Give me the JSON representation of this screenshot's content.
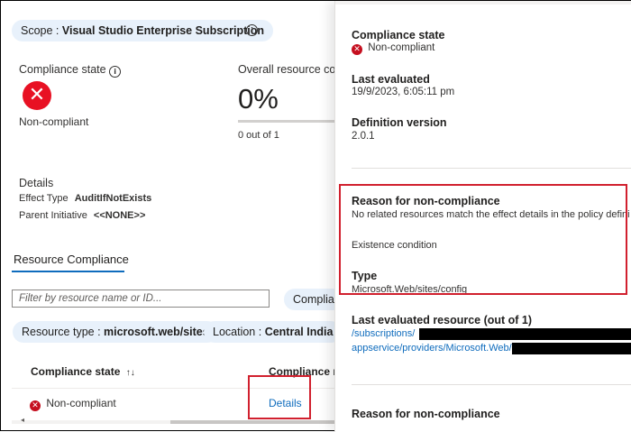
{
  "scope_pill": {
    "label": "Scope : ",
    "value": "Visual Studio Enterprise Subscription"
  },
  "summary": {
    "compliance_state_label": "Compliance state",
    "compliance_state_value": "Non-compliant",
    "overall_label": "Overall resource com",
    "overall_percent": "0%",
    "overall_progress": 0,
    "overall_count": "0 out of 1"
  },
  "details": {
    "heading": "Details",
    "effect_label": "Effect Type",
    "effect_value": "AuditIfNotExists",
    "parent_label": "Parent Initiative",
    "parent_value": "<<NONE>>"
  },
  "tab": {
    "label": "Resource Compliance"
  },
  "filter": {
    "placeholder": "Filter by resource name or ID...",
    "button_label": "Complian"
  },
  "filter_pills": [
    {
      "label": "Resource type : ",
      "value": "microsoft.web/sites"
    },
    {
      "label": "Location : ",
      "value": "Central India"
    }
  ],
  "table": {
    "col1": "Compliance state",
    "sort_glyph": "↑↓",
    "col2": "Compliance re",
    "row": {
      "state": "Non-compliant",
      "link": "Details"
    }
  },
  "panel": {
    "compliance_state_label": "Compliance state",
    "compliance_state_value": "Non-compliant",
    "last_evaluated_label": "Last evaluated",
    "last_evaluated_value": "19/9/2023, 6:05:11 pm",
    "definition_version_label": "Definition version",
    "definition_version_value": "2.0.1",
    "reason_label": "Reason for non-compliance",
    "reason_value": "No related resources match the effect details in the policy defini",
    "existence_label": "Existence condition",
    "type_label": "Type",
    "type_value": "Microsoft.Web/sites/config",
    "last_resource_label": "Last evaluated resource (out of 1)",
    "path1": "/subscriptions/",
    "path2": "appservice/providers/Microsoft.Web/",
    "reason_label_2": "Reason for non-compliance"
  },
  "colors": {
    "accent": "#0f6cbd",
    "error": "#e81123",
    "highlight": "#d1202e",
    "pill_bg": "#e8f1fb"
  }
}
